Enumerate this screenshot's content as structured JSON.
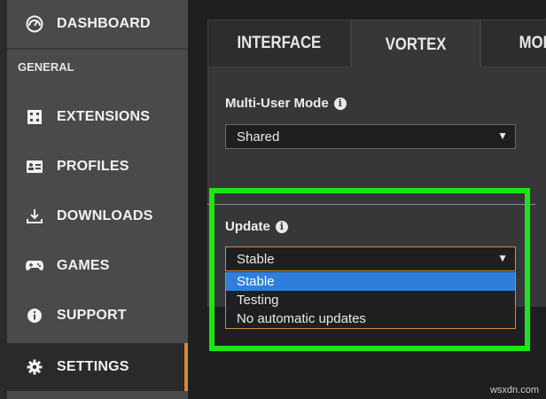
{
  "sidebar": {
    "items": [
      {
        "label": "DASHBOARD",
        "icon": "dashboard-icon"
      },
      {
        "label": "EXTENSIONS",
        "icon": "extensions-icon"
      },
      {
        "label": "PROFILES",
        "icon": "profiles-icon"
      },
      {
        "label": "DOWNLOADS",
        "icon": "downloads-icon"
      },
      {
        "label": "GAMES",
        "icon": "gamepad-icon"
      },
      {
        "label": "SUPPORT",
        "icon": "info-icon"
      },
      {
        "label": "SETTINGS",
        "icon": "gear-icon",
        "active": true
      }
    ],
    "section_general": "GENERAL"
  },
  "tabs": [
    {
      "label": "INTERFACE"
    },
    {
      "label": "VORTEX",
      "active": true
    },
    {
      "label": "MOD"
    }
  ],
  "settings": {
    "multi_user": {
      "label": "Multi-User Mode",
      "value": "Shared"
    },
    "update": {
      "label": "Update",
      "value": "Stable",
      "options": [
        "Stable",
        "Testing",
        "No automatic updates"
      ],
      "selected_option": "Stable"
    }
  },
  "colors": {
    "accent": "#d98a32",
    "highlight_box": "#19e619",
    "selected_option": "#2e7fdc"
  },
  "watermark": "wsxdn.com"
}
